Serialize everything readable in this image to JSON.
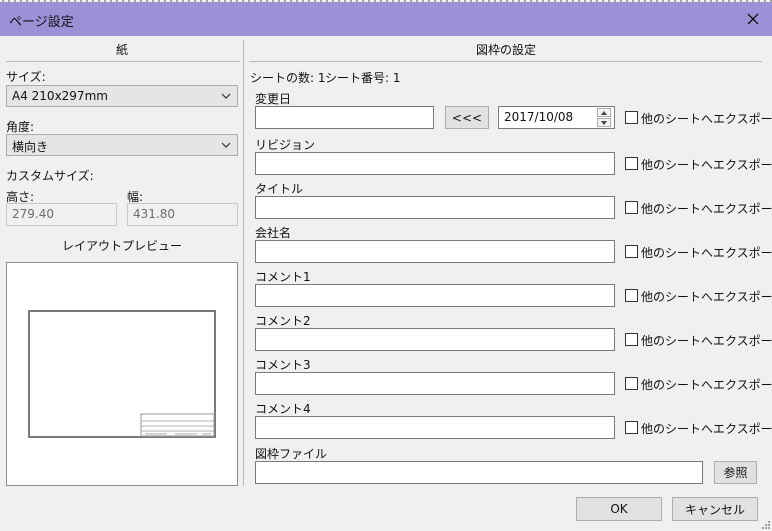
{
  "window": {
    "title": "ページ設定"
  },
  "paper": {
    "section_title": "紙",
    "size_label": "サイズ:",
    "size_value": "A4 210x297mm",
    "angle_label": "角度:",
    "angle_value": "横向き",
    "custom_size_label": "カスタムサイズ:",
    "height_label": "高さ:",
    "height_value": "279.40",
    "width_label": "幅:",
    "width_value": "431.80",
    "preview_label": "レイアウトプレビュー"
  },
  "frame": {
    "section_title": "図枠の設定",
    "sheet_count": "シートの数: 1",
    "sheet_number": "シート番号: 1",
    "fields": [
      {
        "label": "変更日",
        "value": ""
      },
      {
        "label": "リビジョン",
        "value": ""
      },
      {
        "label": "タイトル",
        "value": ""
      },
      {
        "label": "会社名",
        "value": ""
      },
      {
        "label": "コメント1",
        "value": ""
      },
      {
        "label": "コメント2",
        "value": ""
      },
      {
        "label": "コメント3",
        "value": ""
      },
      {
        "label": "コメント4",
        "value": ""
      }
    ],
    "date_button": "<<<",
    "date_value": "2017/10/08",
    "export_label": "他のシートへエクスポート",
    "file_label": "図枠ファイル",
    "file_value": "",
    "browse_button": "参照"
  },
  "footer": {
    "ok": "OK",
    "cancel": "キャンセル"
  }
}
